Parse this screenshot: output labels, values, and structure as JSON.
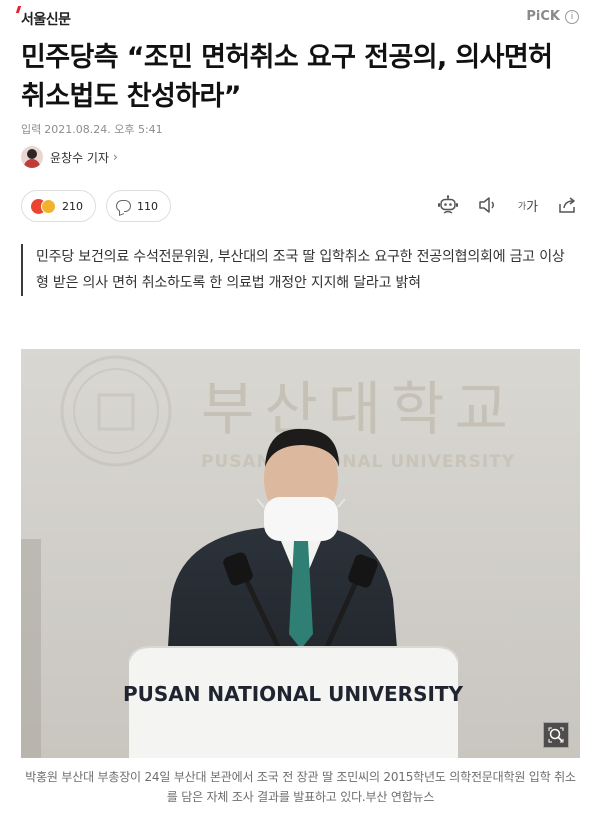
{
  "header": {
    "publisher": "서울신문",
    "pick_label": "PiCK",
    "info_icon": "info-icon"
  },
  "article": {
    "headline": "민주당측 “조민 면허취소 요구 전공의, 의사면허 취소법도 찬성하라”",
    "date_label": "입력",
    "date_value": "2021.08.24. 오후 5:41",
    "reporter": "윤창수 기자",
    "summary": "민주당 보건의료 수석전문위원, 부산대의 조국 딸 입학취소 요구한 전공의협의회에 금고 이상 형 받은 의사 면허 취소하도록 한 의료법 개정안 지지해 달라고 밝혀",
    "photo": {
      "wall_text_kr": "부산대학교",
      "wall_text_en": "PUSAN NATIONAL UNIVERSITY",
      "podium_text": "PUSAN NATIONAL UNIVERSITY",
      "zoom_icon": "zoom-icon"
    },
    "caption": "박홍원 부산대 부총장이 24일 부산대 본관에서 조국 전 장관 딸 조민씨의 2015학년도 의학전문대학원 입학 취소를 담은 자체 조사 결과를 발표하고 있다.부산 연합뉴스"
  },
  "actions": {
    "reaction_count": "210",
    "comment_count": "110",
    "tools": [
      {
        "name": "audio-robot-icon"
      },
      {
        "name": "volume-icon"
      },
      {
        "name": "font-size-icon",
        "label": "가"
      },
      {
        "name": "share-icon"
      }
    ]
  },
  "colors": {
    "brand_red": "#e0262b",
    "text_primary": "#111111",
    "text_muted": "#8d8d8d"
  }
}
